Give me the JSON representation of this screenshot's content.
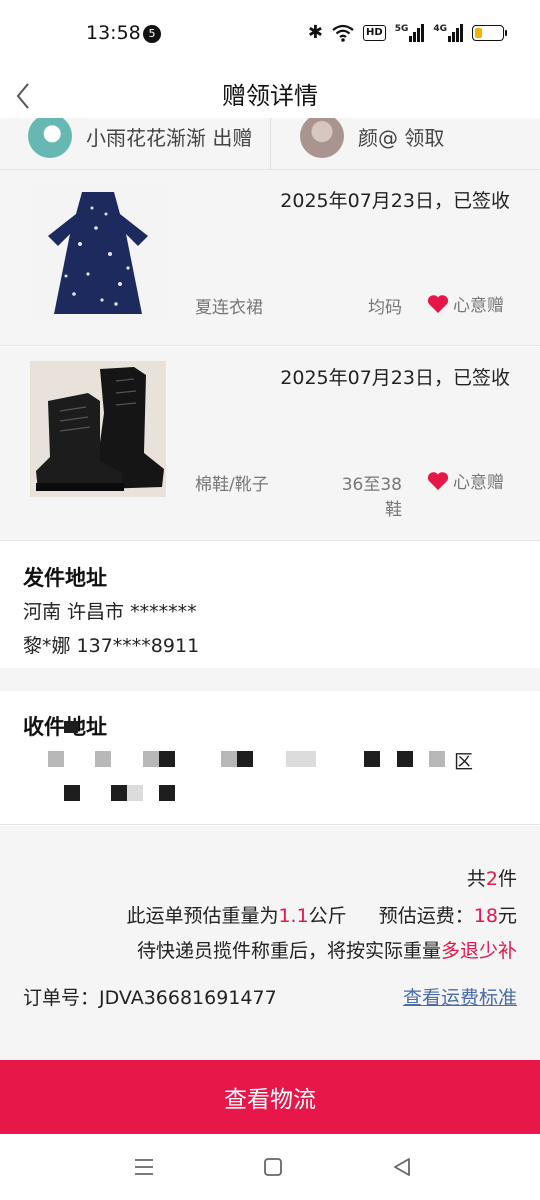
{
  "status_bar": {
    "time": "13:58",
    "notification_count": "5",
    "hd_label": "HD",
    "signal1_label": "5G",
    "signal2_label": "4G",
    "battery_level": 0.25,
    "battery_color": "#f2b400"
  },
  "header": {
    "title": "赠领详情",
    "back_icon": "chevron-left-icon"
  },
  "parties": {
    "giver_name": "小雨花花渐渐 出赠",
    "receiver_name": "颜@ 领取"
  },
  "items": [
    {
      "date_status": "2025年07月23日，已签收",
      "name": "夏连衣裙",
      "size": "均码",
      "tag": "心意赠",
      "tag_icon": "heart-icon"
    },
    {
      "date_status": "2025年07月23日，已签收",
      "name": "棉鞋/靴子",
      "size": "36至38鞋",
      "tag": "心意赠",
      "tag_icon": "heart-icon"
    }
  ],
  "sender_address": {
    "title": "发件地址",
    "line1": "河南 许昌市 *******",
    "line2": "黎*娜 137****8911"
  },
  "receiver_address": {
    "title": "收件地址",
    "district": "区"
  },
  "summary": {
    "count_prefix": "共",
    "count": "2",
    "count_suffix": "件",
    "weight_prefix": "此运单预估重量为",
    "weight": "1.1",
    "weight_unit": "公斤",
    "fee_label": "预估运费：",
    "fee": "18",
    "fee_unit": "元",
    "note_prefix": "待快递员揽件称重后，将按实际重量",
    "note_highlight": "多退少补",
    "order_label": "订单号：",
    "order_number": "JDVA36681691477",
    "fee_link": "查看运费标准"
  },
  "actions": {
    "logistics": "查看物流"
  },
  "colors": {
    "accent": "#e8174a",
    "link": "#4a6ca8",
    "background_gray": "#f5f5f5"
  }
}
